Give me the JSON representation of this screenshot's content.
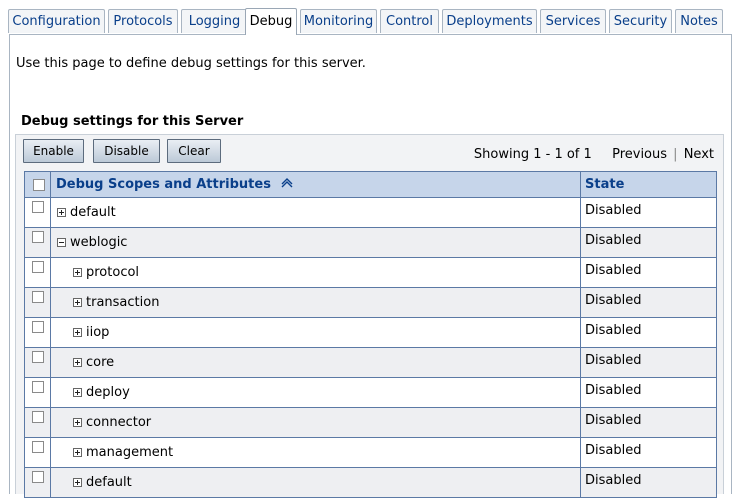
{
  "tabs": [
    {
      "label": "Configuration"
    },
    {
      "label": "Protocols"
    },
    {
      "label": "Logging"
    },
    {
      "label": "Debug"
    },
    {
      "label": "Monitoring"
    },
    {
      "label": "Control"
    },
    {
      "label": "Deployments"
    },
    {
      "label": "Services"
    },
    {
      "label": "Security"
    },
    {
      "label": "Notes"
    }
  ],
  "active_tab": "Debug",
  "intro_text": "Use this page to define debug settings for this server.",
  "section_title": "Debug settings for this Server",
  "buttons": {
    "enable": "Enable",
    "disable": "Disable",
    "clear": "Clear"
  },
  "pager": {
    "showing": "Showing 1 - 1 of 1",
    "previous": "Previous",
    "separator": "|",
    "next": "Next"
  },
  "table": {
    "headers": {
      "scope": "Debug Scopes and Attributes",
      "state": "State"
    },
    "rows": [
      {
        "name": "default",
        "state": "Disabled",
        "expanded": false,
        "level": 0
      },
      {
        "name": "weblogic",
        "state": "Disabled",
        "expanded": true,
        "level": 0
      },
      {
        "name": "protocol",
        "state": "Disabled",
        "expanded": false,
        "level": 1
      },
      {
        "name": "transaction",
        "state": "Disabled",
        "expanded": false,
        "level": 1
      },
      {
        "name": "iiop",
        "state": "Disabled",
        "expanded": false,
        "level": 1
      },
      {
        "name": "core",
        "state": "Disabled",
        "expanded": false,
        "level": 1
      },
      {
        "name": "deploy",
        "state": "Disabled",
        "expanded": false,
        "level": 1
      },
      {
        "name": "connector",
        "state": "Disabled",
        "expanded": false,
        "level": 1
      },
      {
        "name": "management",
        "state": "Disabled",
        "expanded": false,
        "level": 1
      },
      {
        "name": "default",
        "state": "Disabled",
        "expanded": false,
        "level": 1
      }
    ]
  },
  "colors": {
    "link": "#0a3f8a",
    "header_bg": "#c6d5ea",
    "grid_border": "#5b79a5"
  }
}
